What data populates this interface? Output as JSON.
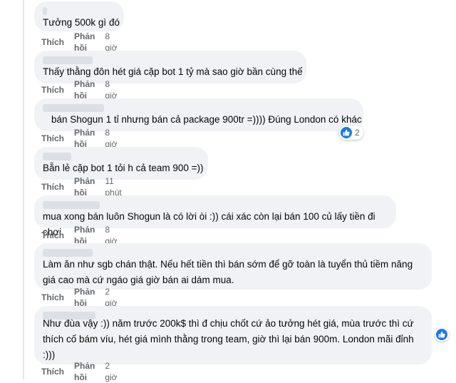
{
  "actions": {
    "like": "Thích",
    "reply": "Phản hồi"
  },
  "comments": [
    {
      "text": "Tưởng 500k gì đó",
      "time": "8 giờ"
    },
    {
      "text": "Thấy thằng đôn hét giá cặp bot 1 tỷ mà sao giờ bần cùng thế",
      "time": "8 giờ"
    },
    {
      "text": "bán Shogun 1 tỉ nhưng bán cả package 900tr =)))) Đúng London có khác",
      "time": "8 giờ",
      "reaction_count": "2",
      "reaction_icon": "like-icon"
    },
    {
      "text": "Bẵn lẻ cặp bot 1 tỏi h cả team 900 =))",
      "time": "11 phút"
    },
    {
      "text": "mua xong bán luôn Shogun là có lời òi :)) cái xác còn lại bán 100 củ lấy tiền đi chơi",
      "time": "8 giờ"
    },
    {
      "text": "Làm ăn như sgb chán thật. Nếu hết tiền thì bán sớm để gỡ toàn là tuyển thủ tiềm năng giá cao mà cứ ngáo giá giờ bán ai dám mua.",
      "time": "2 giờ"
    },
    {
      "text": "Như đùa vậy :)) năm trước 200k$ thì đ chịu chốt cứ ảo tưởng hét giá, mùa trước thì cứ thích cố bám víu, hét giá mình thằng trong team, giờ thì lại bán 900m. London mãi đỉnh :)))",
      "time": "2 giờ",
      "reaction_count": "",
      "reaction_icon": "like-icon"
    }
  ],
  "colors": {
    "bubble": "#f0f2f5",
    "meta": "#65676b",
    "like": "#1877f2"
  }
}
